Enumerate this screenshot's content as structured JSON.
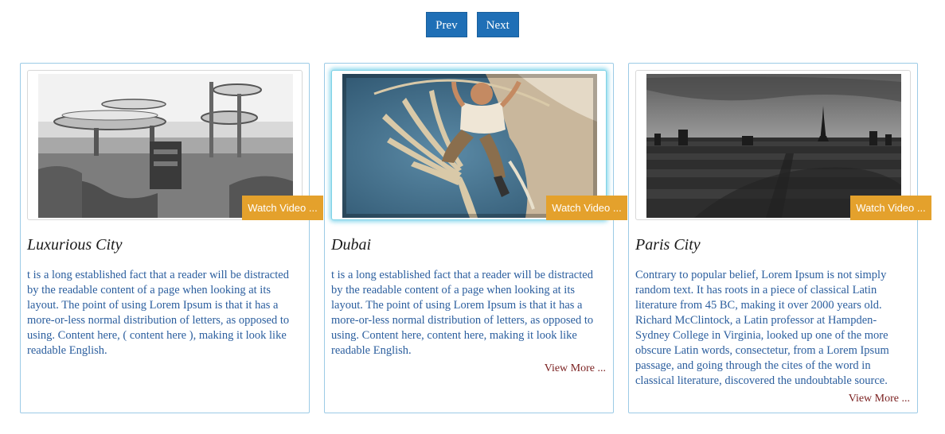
{
  "nav": {
    "prev_label": "Prev",
    "next_label": "Next"
  },
  "cards": [
    {
      "title": "Luxurious City",
      "watch_label": "Watch Video ...",
      "description": "t is a long established fact that a reader will be distracted by the readable content of a page when looking at its layout. The point of using Lorem Ipsum is that it has a more-or-less normal distribution of letters, as opposed to using. Content here, ( content here ), making it look like readable English.",
      "more_label": ""
    },
    {
      "title": "Dubai",
      "watch_label": "Watch Video ...",
      "description": "t is a long established fact that a reader will be distracted by the readable content of a page when looking at its layout. The point of using Lorem Ipsum is that it has a more-or-less normal distribution of letters, as opposed to using. Content here, content here, making it look like readable English.",
      "more_label": "View More ..."
    },
    {
      "title": "Paris City",
      "watch_label": "Watch Video ...",
      "description": "Contrary to popular belief, Lorem Ipsum is not simply random text. It has roots in a piece of classical Latin literature from 45 BC, making it over 2000 years old. Richard McClintock, a Latin professor at Hampden-Sydney College in Virginia, looked up one of the more obscure Latin words, consectetur, from a Lorem Ipsum passage, and going through the cites of the word in classical literature, discovered the undoubtable source.",
      "more_label": "View More ..."
    }
  ],
  "colors": {
    "primary": "#1f6fb6",
    "accent": "#e4a12c",
    "text": "#2b5e9e",
    "link": "#7a1f1f"
  }
}
